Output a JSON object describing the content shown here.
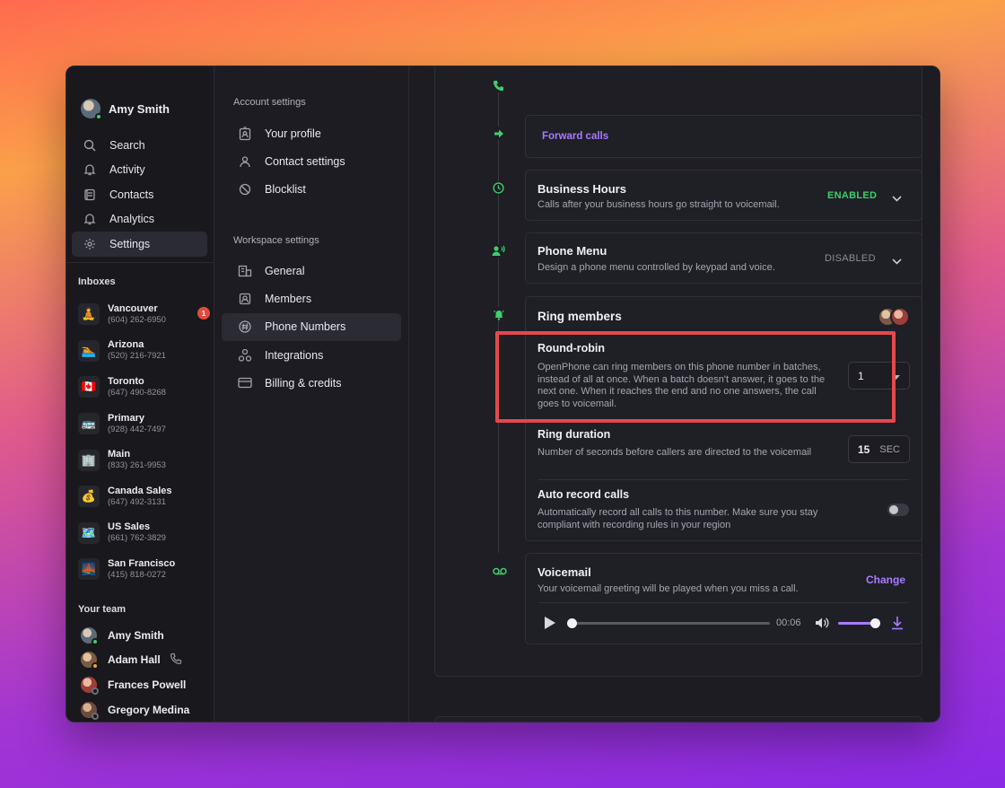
{
  "user": {
    "name": "Amy Smith"
  },
  "nav": [
    {
      "label": "Search",
      "icon": "search-icon"
    },
    {
      "label": "Activity",
      "icon": "bell-icon"
    },
    {
      "label": "Contacts",
      "icon": "contacts-icon"
    },
    {
      "label": "Analytics",
      "icon": "analytics-icon"
    },
    {
      "label": "Settings",
      "icon": "gear-icon"
    }
  ],
  "inboxes_label": "Inboxes",
  "inboxes": [
    {
      "emoji": "🧘",
      "name": "Vancouver",
      "phone": "(604) 262-6950",
      "badge": "1"
    },
    {
      "emoji": "🏊",
      "name": "Arizona",
      "phone": "(520) 216-7921"
    },
    {
      "emoji": "🇨🇦",
      "name": "Toronto",
      "phone": "(647) 490-8268"
    },
    {
      "emoji": "🚌",
      "name": "Primary",
      "phone": "(928) 442-7497"
    },
    {
      "emoji": "🏢",
      "name": "Main",
      "phone": "(833) 261-9953"
    },
    {
      "emoji": "💰",
      "name": "Canada Sales",
      "phone": "(647) 492-3131"
    },
    {
      "emoji": "🗺️",
      "name": "US Sales",
      "phone": "(661) 762-3829"
    },
    {
      "emoji": "🌉",
      "name": "San Francisco",
      "phone": "(415) 818-0272"
    }
  ],
  "team_label": "Your team",
  "team": [
    {
      "name": "Amy Smith",
      "status": "online"
    },
    {
      "name": "Adam Hall",
      "status": "on-call"
    },
    {
      "name": "Frances Powell",
      "status": "offline"
    },
    {
      "name": "Gregory Medina",
      "status": "offline"
    }
  ],
  "settings": {
    "account_label": "Account settings",
    "account_items": [
      "Your profile",
      "Contact settings",
      "Blocklist"
    ],
    "workspace_label": "Workspace settings",
    "workspace_items": [
      "General",
      "Members",
      "Phone Numbers",
      "Integrations",
      "Billing & credits"
    ]
  },
  "flow": {
    "forward": "Forward calls",
    "business_hours": {
      "title": "Business Hours",
      "desc": "Calls after your business hours go straight to voicemail.",
      "status": "ENABLED"
    },
    "phone_menu": {
      "title": "Phone Menu",
      "desc": "Design a phone menu controlled by keypad and voice.",
      "status": "DISABLED"
    },
    "ring_members": {
      "title": "Ring members",
      "round_robin": {
        "title": "Round-robin",
        "desc": "OpenPhone can ring members on this phone number in batches, instead of all at once. When a batch doesn't answer, it goes to the next one. When it reaches the end and no one answers, the call goes to voicemail.",
        "value": "1"
      },
      "ring_duration": {
        "title": "Ring duration",
        "desc": "Number of seconds before callers are directed to the voicemail",
        "value": "15",
        "unit": "SEC"
      },
      "auto_record": {
        "title": "Auto record calls",
        "desc": "Automatically record all calls to this number. Make sure you stay compliant with recording rules in your region",
        "enabled": false
      }
    },
    "voicemail": {
      "title": "Voicemail",
      "desc": "Your voicemail greeting will be played when you miss a call.",
      "action": "Change",
      "time": "00:06",
      "progress": 0.0,
      "volume": 1.0
    }
  },
  "colors": {
    "accent": "#a67cff",
    "green": "#3ecf6e",
    "highlight": "#e5484d"
  }
}
